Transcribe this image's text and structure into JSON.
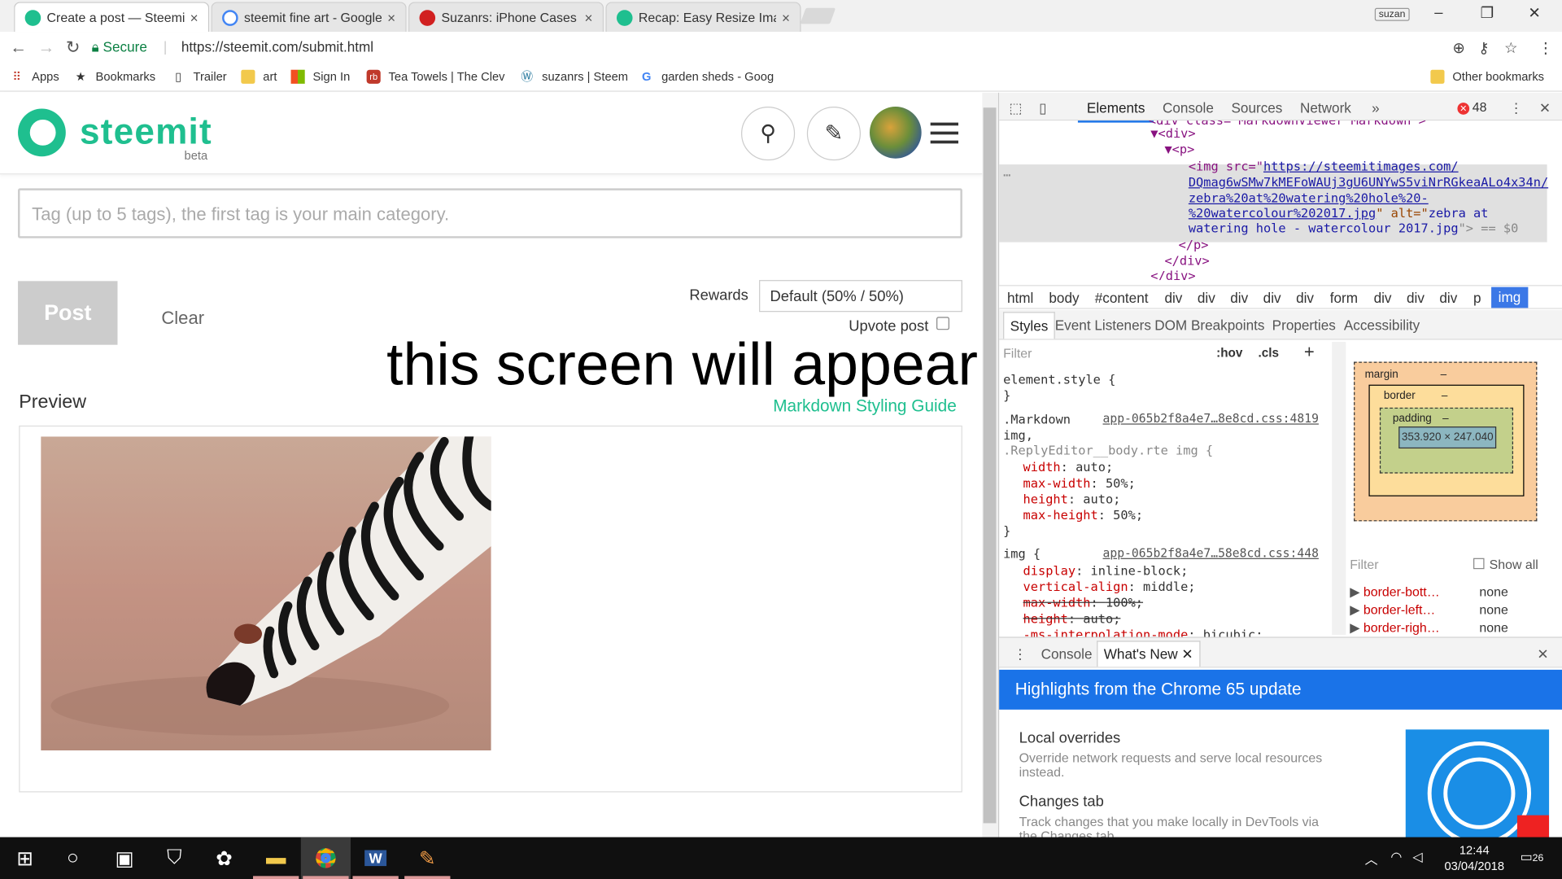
{
  "browser": {
    "tabs": [
      {
        "title": "Create a post — Steemit",
        "color": "#1fbf8f"
      },
      {
        "title": "steemit fine art - Google",
        "color": "#4285f4"
      },
      {
        "title": "Suzanrs: iPhone Cases &",
        "color": "#d12020"
      },
      {
        "title": "Recap: Easy Resize Image",
        "color": "#1fbf8f"
      }
    ],
    "tab_close": "×",
    "user_badge": "suzan",
    "window_min": "–",
    "window_restore": "❐",
    "window_close": "✕",
    "secure_label": "Secure",
    "url": "https://steemit.com/submit.html",
    "bookmarks": [
      {
        "label": "Apps",
        "icon": "apps-grid-icon"
      },
      {
        "label": "Bookmarks",
        "icon": "star-icon"
      },
      {
        "label": "Trailer",
        "icon": "page-icon"
      },
      {
        "label": "art",
        "icon": "folder-icon"
      },
      {
        "label": "Sign In",
        "icon": "microsoft-icon"
      },
      {
        "label": "Tea Towels | The Clev",
        "icon": "redbubble-icon"
      },
      {
        "label": "suzanrs | Steem",
        "icon": "wordpress-icon"
      },
      {
        "label": "garden sheds - Goog",
        "icon": "google-icon"
      }
    ],
    "other_bookmarks": "Other bookmarks"
  },
  "steemit": {
    "logo_text": "steemit",
    "beta": "beta",
    "tag_placeholder": "Tag (up to 5 tags), the first tag is your main category.",
    "post_label": "Post",
    "clear_label": "Clear",
    "rewards_label": "Rewards",
    "rewards_value": "Default (50% / 50%)",
    "upvote_label": "Upvote post",
    "overlay_text": "this screen will appear",
    "preview_label": "Preview",
    "markdown_guide": "Markdown Styling Guide",
    "accent": "#1fbf8f"
  },
  "devtools": {
    "tabs": [
      "Elements",
      "Console",
      "Sources",
      "Network",
      "»"
    ],
    "error_count": "48",
    "dom_lines": {
      "l0": "<div class=\"MarkdownViewer Markdown\">",
      "l1": "▼<div>",
      "l2": "▼<p>",
      "img_open": "<img src=\"",
      "img_url1": "https://steemitimages.com/",
      "img_url2": "DQmag6wSMw7kMEFoWAUj3gU6UNYwS5viNrRGkeaALo4x34n/",
      "img_url3": "zebra%20at%20watering%20hole%20-",
      "img_url4": "%20watercolour%202017.jpg",
      "img_alt_label": "\" alt=\"",
      "img_alt1": "zebra at",
      "img_alt2": "watering hole - watercolour 2017.jpg",
      "img_tail": "\"> == $0",
      "l3": "</p>",
      "l4": "</div>",
      "l5": "</div>",
      "ellipsis": "…"
    },
    "breadcrumbs": [
      "html",
      "body",
      "#content",
      "div",
      "div",
      "div",
      "div",
      "div",
      "form",
      "div",
      "div",
      "div",
      "p",
      "img"
    ],
    "style_tabs": [
      "Styles",
      "Event Listeners",
      "DOM Breakpoints",
      "Properties",
      "Accessibility"
    ],
    "filter_placeholder": "Filter",
    "hov": ":hov",
    "cls": ".cls",
    "plus": "+",
    "styles": {
      "element_style": "element.style {",
      "close": "}",
      "rule1_sel1": ".Markdown",
      "rule1_src": "app-065b2f8a4e7…8e8cd.css:4819",
      "rule1_sel2": "img,",
      "rule1_sel3": ".ReplyEditor__body.rte img {",
      "rule1_props": [
        {
          "name": "width",
          "value": "auto;"
        },
        {
          "name": "max-width",
          "value": "50%;"
        },
        {
          "name": "height",
          "value": "auto;"
        },
        {
          "name": "max-height",
          "value": "50%;"
        }
      ],
      "rule2_sel": "img {",
      "rule2_src": "app-065b2f8a4e7…58e8cd.css:448",
      "rule2_props": [
        {
          "name": "display",
          "value": "inline-block;",
          "struck": false
        },
        {
          "name": "vertical-align",
          "value": "middle;",
          "struck": false
        },
        {
          "name": "max-width",
          "value": "100%;",
          "struck": true
        },
        {
          "name": "height",
          "value": "auto;",
          "struck": true
        },
        {
          "name": "-ms-interpolation-mode",
          "value": "bicubic;",
          "struck": false
        }
      ]
    },
    "box_model": {
      "margin": "margin",
      "border": "border",
      "padding": "padding",
      "dash": "–",
      "content_size": "353.920 × 247.040"
    },
    "computed": {
      "filter": "Filter",
      "show_all": "Show all",
      "props": [
        {
          "name": "border-bott…",
          "value": "none"
        },
        {
          "name": "border-left…",
          "value": "none"
        },
        {
          "name": "border-righ…",
          "value": "none"
        }
      ]
    },
    "drawer_tabs": [
      "Console",
      "What's New"
    ],
    "whats_new_header": "Highlights from the Chrome 65 update",
    "items": [
      {
        "title": "Local overrides",
        "desc": "Override network requests and serve local resources instead."
      },
      {
        "title": "Changes tab",
        "desc": "Track changes that you make locally in DevTools via the Changes tab."
      }
    ]
  },
  "taskbar": {
    "time": "12:44",
    "date": "03/04/2018",
    "notifications": "26"
  }
}
